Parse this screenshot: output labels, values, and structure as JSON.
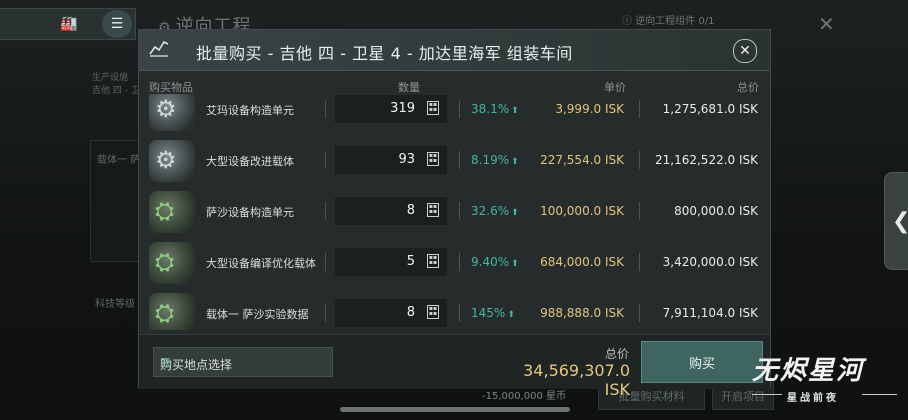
{
  "background": {
    "title": "逆向工程",
    "status": "逆向工程组件 0/1",
    "production_label": "生产设施",
    "production_sub": "吉他 四 - 卫...",
    "carrier_label": "载体一 萨",
    "tech_label": "科技等级",
    "cost": "-15,000,000 星币",
    "bulk_buy_button": "批量购买材料",
    "start_button": "开启项目"
  },
  "modal": {
    "title": "批量购买 - 吉他 四 - 卫星 4 - 加达里海军 组装车间",
    "columns": {
      "item": "购买物品",
      "qty": "数量",
      "unit_price": "单价",
      "total": "总价"
    },
    "rows": [
      {
        "name": "艾玛设备构造单元",
        "qty": "319",
        "pct": "38.1%",
        "price": "3,999.0 ISK",
        "total": "1,275,681.0 ISK",
        "icon": "gear-component-icon"
      },
      {
        "name": "大型设备改进载体",
        "qty": "93",
        "pct": "8.19%",
        "price": "227,554.0 ISK",
        "total": "21,162,522.0 ISK",
        "icon": "gear-component-icon"
      },
      {
        "name": "萨沙设备构造单元",
        "qty": "8",
        "pct": "32.6%",
        "price": "100,000.0 ISK",
        "total": "800,000.0 ISK",
        "icon": "module-component-icon"
      },
      {
        "name": "大型设备编译优化载体",
        "qty": "5",
        "pct": "9.40%",
        "price": "684,000.0 ISK",
        "total": "3,420,000.0 ISK",
        "icon": "module-component-icon"
      },
      {
        "name": "载体一 萨沙实验数据",
        "qty": "8",
        "pct": "145%",
        "price": "988,888.0 ISK",
        "total": "7,911,104.0 ISK",
        "icon": "data-component-icon"
      }
    ],
    "footer": {
      "location_label": "购买地点选择",
      "sum_label": "总价",
      "sum_value": "34,569,307.0 ISK",
      "buy_label": "购买"
    }
  },
  "watermark": {
    "main": "无烬星河",
    "sub": "星战前夜"
  },
  "colors": {
    "price": "#e3c57a",
    "percent": "#43b7a0",
    "buy_button": "#3f6560"
  }
}
